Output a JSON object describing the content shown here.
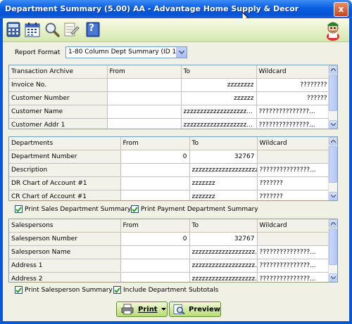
{
  "window": {
    "title": "Department Summary (5.00) AA - Advantage Home Supply & Decor",
    "close_glyph": "x"
  },
  "toolbar": {
    "icons": [
      "calculator-icon",
      "calendar-icon",
      "search-icon",
      "notes-icon",
      "help-icon"
    ],
    "help_glyph": "?"
  },
  "report_format": {
    "label": "Report Format",
    "value": "1-80 Column Dept Summary (ID 1)"
  },
  "transaction_archive": {
    "headers": [
      "Transaction Archive",
      "From",
      "To",
      "Wildcard"
    ],
    "rows": [
      {
        "label": "Invoice No.",
        "from": "",
        "to": "zzzzzzzz",
        "wildcard": "????????"
      },
      {
        "label": "Customer Number",
        "from": "",
        "to": "zzzzzz",
        "wildcard": "??????"
      },
      {
        "label": "Customer Name",
        "from": "",
        "to": "zzzzzzzzzzzzzzzzzzz...",
        "wildcard": "???????????????..."
      },
      {
        "label": "Customer Addr 1",
        "from": "",
        "to": "zzzzzzzzzzzzzzzzzzz...",
        "wildcard": "???????????????..."
      }
    ]
  },
  "departments": {
    "headers": [
      "Departments",
      "From",
      "To",
      "Wildcard"
    ],
    "rows": [
      {
        "label": "Department Number",
        "from": "0",
        "to": "32767",
        "wildcard": ""
      },
      {
        "label": "Description",
        "from": "",
        "to": "zzzzzzzzzzzzzzzzzzzz",
        "wildcard": "???????????????..."
      },
      {
        "label": "DR Chart of Account #1",
        "from": "",
        "to": "zzzzzzz",
        "wildcard": "???????"
      },
      {
        "label": "CR Chart of Account #1",
        "from": "",
        "to": "zzzzzzz",
        "wildcard": "???????"
      }
    ]
  },
  "dept_checks": {
    "print_sales_dept_summary": "Print Sales Department Summary",
    "print_payment_dept_summary": "Print Payment Department Summary"
  },
  "salespersons": {
    "headers": [
      "Salespersons",
      "From",
      "To",
      "Wildcard"
    ],
    "rows": [
      {
        "label": "Salesperson Number",
        "from": "0",
        "to": "32767",
        "wildcard": ""
      },
      {
        "label": "Salesperson Name",
        "from": "",
        "to": "zzzzzzzzzzzzzzzzzzz...",
        "wildcard": "???????????????..."
      },
      {
        "label": "Address 1",
        "from": "",
        "to": "zzzzzzzzzzzzzzzzzzz...",
        "wildcard": "???????????????..."
      },
      {
        "label": "Address 2",
        "from": "",
        "to": "zzzzzzzzzzzzzzzzzzz...",
        "wildcard": "???????????????..."
      }
    ]
  },
  "sales_checks": {
    "print_salesperson_summary": "Print Salesperson Summary",
    "include_dept_subtotals": "Include Department Subtotals"
  },
  "buttons": {
    "print": "Print",
    "preview": "Preview"
  },
  "colors": {
    "titlebar": "#0a56d8",
    "toolbar": "#d5e7ae",
    "button_green": "#b8dc74"
  }
}
